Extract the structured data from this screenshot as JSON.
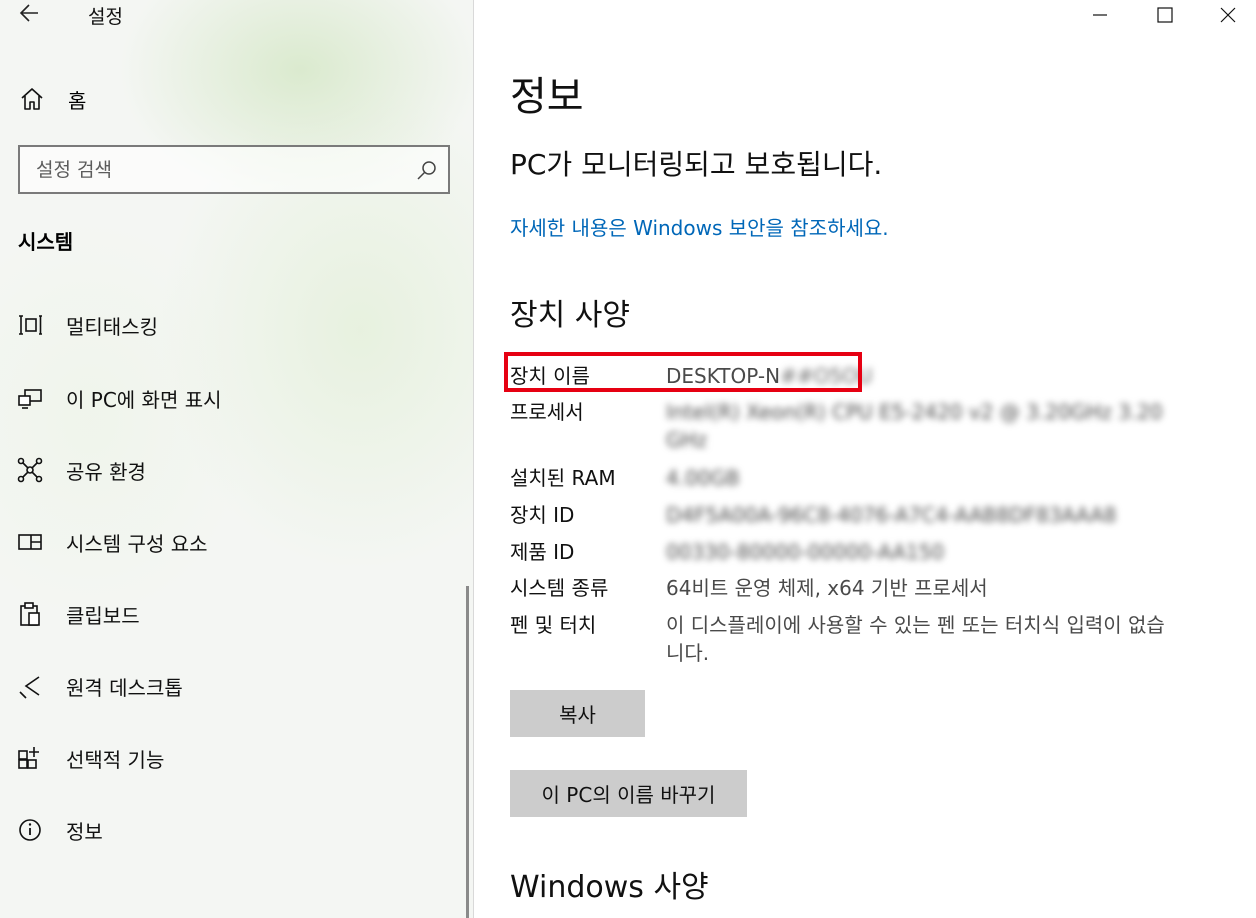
{
  "window": {
    "app_title": "설정",
    "controls": {
      "minimize": "minimize-icon",
      "maximize": "maximize-icon",
      "close": "close-icon"
    }
  },
  "sidebar": {
    "home_label": "홈",
    "search_placeholder": "설정 검색",
    "section_title": "시스템",
    "items": [
      {
        "label": "멀티태스킹",
        "icon": "multitasking-icon"
      },
      {
        "label": "이 PC에 화면 표시",
        "icon": "project-icon"
      },
      {
        "label": "공유 환경",
        "icon": "share-icon"
      },
      {
        "label": "시스템 구성 요소",
        "icon": "components-icon"
      },
      {
        "label": "클립보드",
        "icon": "clipboard-icon"
      },
      {
        "label": "원격 데스크톱",
        "icon": "remote-desktop-icon"
      },
      {
        "label": "선택적 기능",
        "icon": "optional-features-icon"
      },
      {
        "label": "정보",
        "icon": "info-icon"
      }
    ]
  },
  "main": {
    "title": "정보",
    "status": "PC가 모니터링되고 보호됩니다.",
    "link": "자세한 내용은 Windows 보안을 참조하세요.",
    "device_specs_heading": "장치 사양",
    "specs": [
      {
        "key": "장치 이름",
        "value": "DESKTOP-N",
        "value_blurred": "##O5OU"
      },
      {
        "key": "프로세서",
        "value_blurred": "Intel(R) Xeon(R) CPU E5-2420 v2 @ 3.20GHz   3.20 GHz"
      },
      {
        "key": "설치된 RAM",
        "value_blurred": "4.00GB"
      },
      {
        "key": "장치 ID",
        "value_blurred": "D4F5A00A-96C8-4076-A7C4-AAB8DF83AAA8"
      },
      {
        "key": "제품 ID",
        "value_blurred": "00330-80000-00000-AA150"
      },
      {
        "key": "시스템 종류",
        "value": "64비트 운영 체제, x64 기반 프로세서"
      },
      {
        "key": "펜 및 터치",
        "value": "이 디스플레이에 사용할 수 있는 펜 또는 터치식 입력이 없습니다."
      }
    ],
    "copy_button": "복사",
    "rename_button": "이 PC의 이름 바꾸기",
    "windows_specs_heading": "Windows 사양"
  },
  "colors": {
    "accent_link": "#0067b8",
    "highlight_border": "#e60012",
    "button_bg": "#cccccc"
  }
}
